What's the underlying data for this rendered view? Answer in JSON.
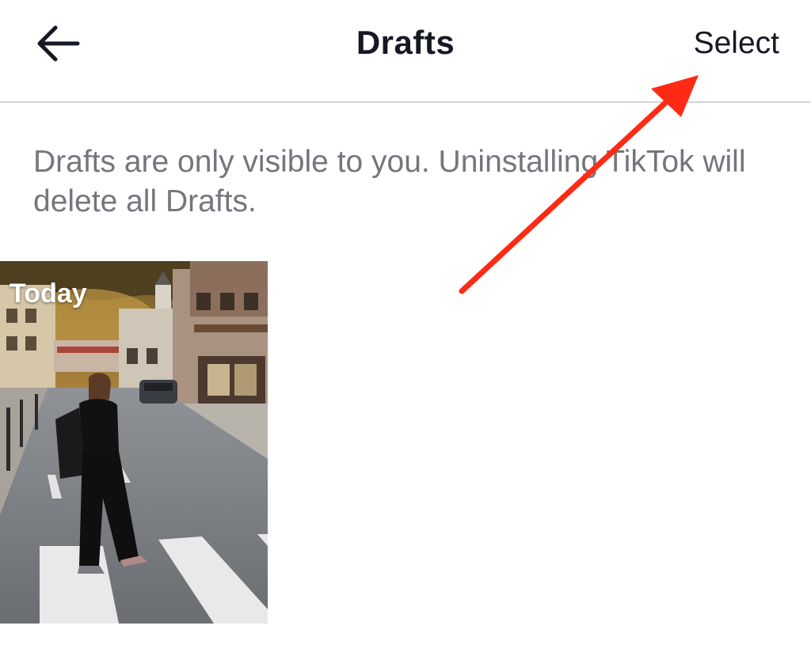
{
  "header": {
    "back_icon": "arrow-left-icon",
    "title": "Drafts",
    "select_label": "Select"
  },
  "notice": {
    "text": "Drafts are only visible to you. Uninstalling TikTok will delete all Drafts."
  },
  "drafts": [
    {
      "date_label": "Today"
    }
  ],
  "annotation": {
    "arrow_color": "#ff2a14"
  },
  "colors": {
    "background": "#ffffff",
    "title": "#161823",
    "notice_text": "#75767d",
    "divider": "#d6d6d8"
  }
}
